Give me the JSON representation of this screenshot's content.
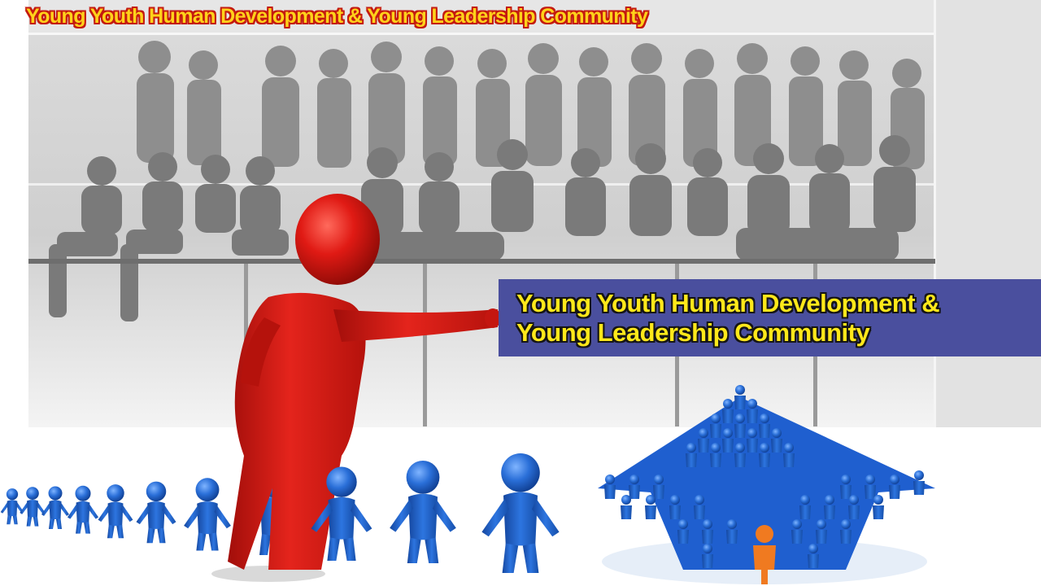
{
  "header": {
    "title": "Young Youth Human Development &  Young Leadership Community"
  },
  "banner": {
    "line1": "Young Youth Human Development &",
    "line2": "Young Leadership Community"
  },
  "colors": {
    "title_fill": "#ffd21a",
    "title_outline": "#c41a10",
    "banner_background": "#4a4f9e",
    "banner_text": "#ffe81a",
    "leader_figure": "#e01a14",
    "follower_figures": "#1f5fcf",
    "arrow_leader_figure": "#f07a20"
  },
  "image": {
    "background_photo": "group-photo",
    "leader": "red-leader-figure",
    "chain": "blue-figures-holding-hands",
    "arrow": "crowd-arrow-formation"
  }
}
